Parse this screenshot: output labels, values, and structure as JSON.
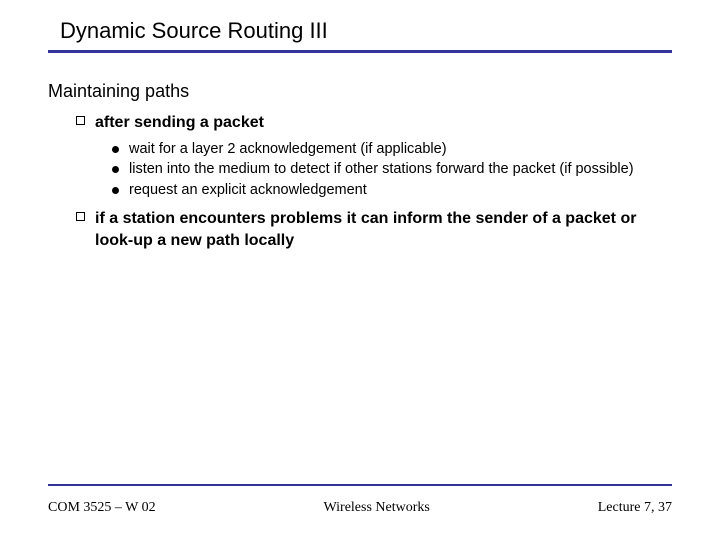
{
  "title": "Dynamic Source Routing III",
  "section_heading": "Maintaining paths",
  "bullets": {
    "b1": "after sending a packet",
    "b1_subs": {
      "s1": "wait for a layer 2 acknowledgement (if applicable)",
      "s2": "listen into the medium to detect if other stations forward the packet (if possible)",
      "s3": "request an explicit acknowledgement"
    },
    "b2": "if a station encounters problems it can inform the sender of a packet or look-up a new path locally"
  },
  "footer": {
    "left": "COM 3525 – W 02",
    "center": "Wireless Networks",
    "right": "Lecture 7, 37"
  }
}
